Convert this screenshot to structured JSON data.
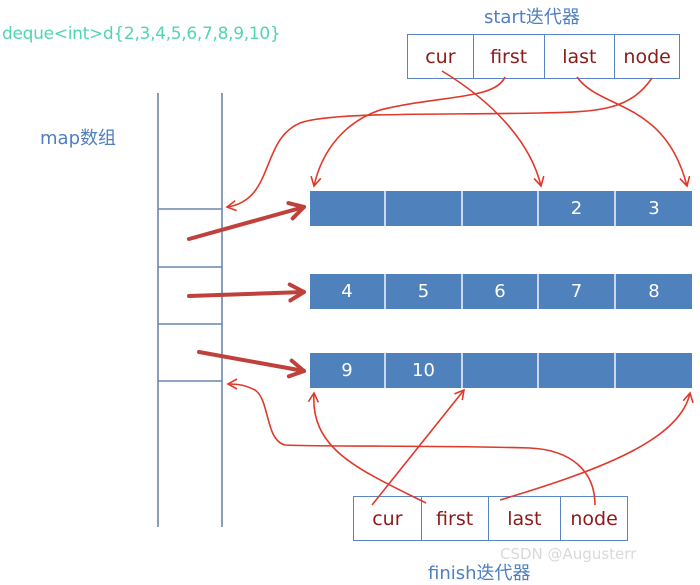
{
  "title": "deque<int>d{2,3,4,5,6,7,8,9,10}",
  "map": {
    "label": "map数组"
  },
  "start_iterator": {
    "label": "start迭代器",
    "fields": [
      "cur",
      "first",
      "last",
      "node"
    ]
  },
  "finish_iterator": {
    "label": "finish迭代器",
    "fields": [
      "cur",
      "first",
      "last",
      "node"
    ]
  },
  "buffers": [
    {
      "cells": [
        "",
        "",
        "",
        "2",
        "3"
      ]
    },
    {
      "cells": [
        "4",
        "5",
        "6",
        "7",
        "8"
      ]
    },
    {
      "cells": [
        "9",
        "10",
        "",
        "",
        ""
      ]
    }
  ],
  "watermark": "CSDN @Augusterr",
  "colors": {
    "title": "#4fd6b2",
    "label": "#4f7fbf",
    "buffer_fill": "#4f81bd",
    "iterator_text": "#8b1a1a",
    "pointer_arrow": "#e0392b",
    "map_arrow": "#c0403c"
  }
}
